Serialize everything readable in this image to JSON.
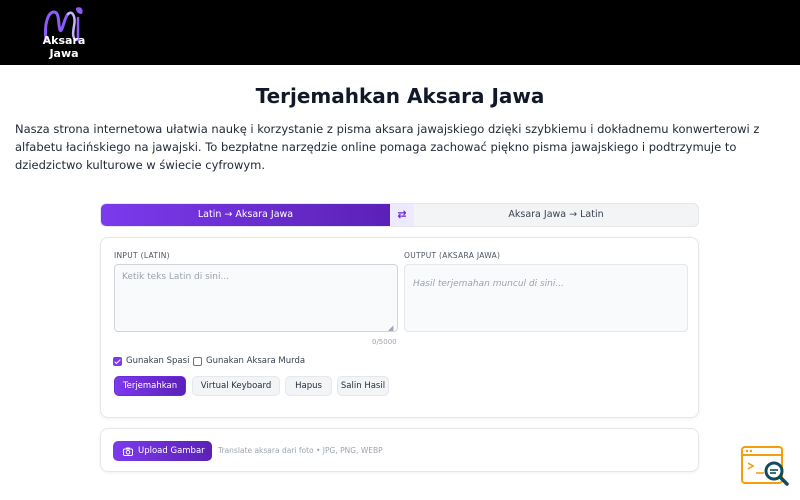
{
  "header": {
    "logo_text": "Aksara Jawa",
    "colors": {
      "background": "#000000",
      "logo_accent": "#7c3aed"
    }
  },
  "main": {
    "title": "Terjemahkan Aksara Jawa",
    "intro": "Nasza strona internetowa ułatwia naukę i korzystanie z pisma aksara jawajskiego dzięki szybkiemu i dokładnemu konwerterowi z alfabetu łacińskiego na jawajski. To bezpłatne narzędzie online pomaga zachować piękno pisma jawajskiego i podtrzymuje to dziedzictwo kulturowe w świecie cyfrowym."
  },
  "mode_switch": {
    "left_label": "Latin → Aksara Jawa",
    "swap_icon": "swap-arrows-icon",
    "swap_glyph": "⇄",
    "right_label": "Aksara Jawa → Latin",
    "active": "left"
  },
  "translator": {
    "input_label": "INPUT (LATIN)",
    "input_placeholder": "Ketik teks Latin di sini...",
    "input_value": "",
    "output_label": "OUTPUT (AKSARA JAWA)",
    "output_placeholder": "Hasil terjemahan muncul di sini...",
    "counter": "0/5000",
    "options": [
      {
        "label": "Gunakan Spasi",
        "checked": true
      },
      {
        "label": "Gunakan Aksara Murda",
        "checked": false
      }
    ],
    "buttons": {
      "translate": "Terjemahkan",
      "keyboard": "Virtual Keyboard",
      "clear": "Hapus",
      "copy": "Salin Hasil"
    }
  },
  "upload": {
    "button_label": "Upload Gambar",
    "icon": "camera-icon",
    "hint": "Translate aksara dari foto • JPG, PNG, WEBP"
  },
  "accent_color": "#7c3aed"
}
